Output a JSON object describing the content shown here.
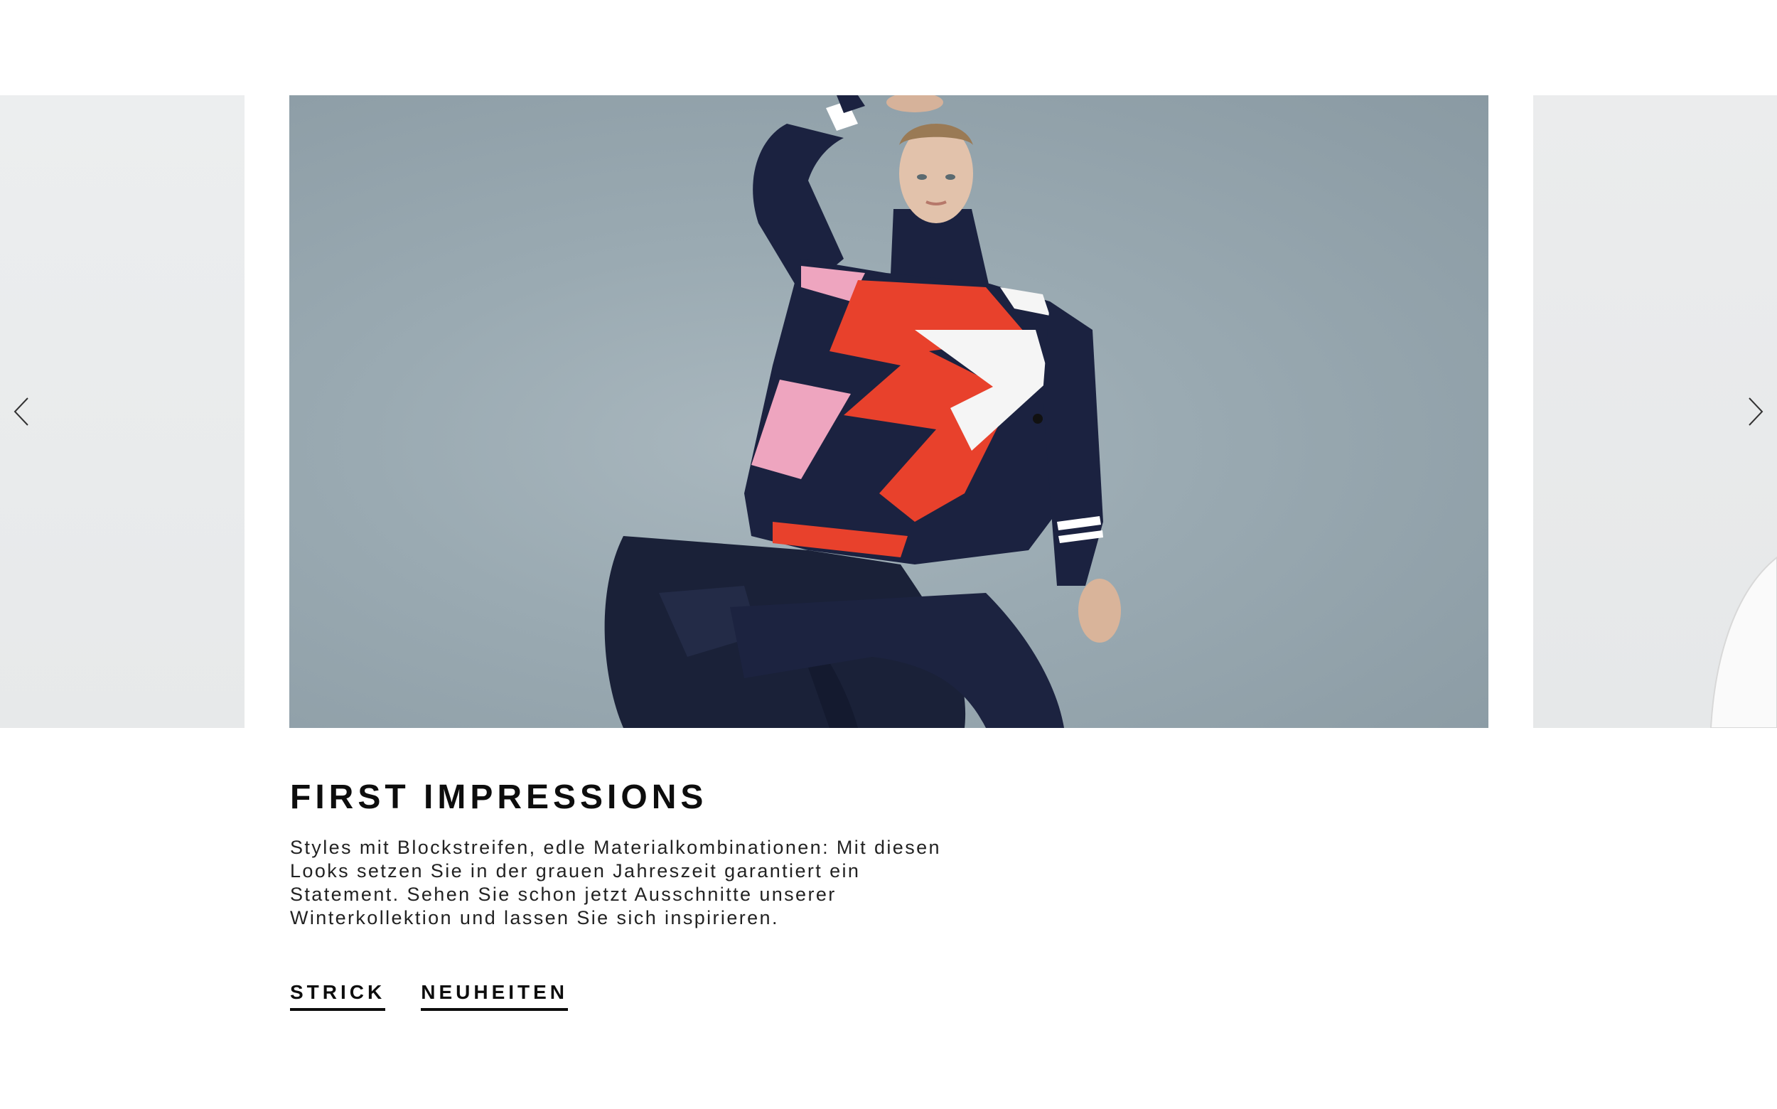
{
  "carousel": {
    "slides": [
      {
        "name": "previous-slide"
      },
      {
        "name": "current-slide",
        "image": "model-in-knit-sweater"
      },
      {
        "name": "next-slide"
      }
    ],
    "prev_icon": "chevron-left-icon",
    "next_icon": "chevron-right-icon"
  },
  "feature": {
    "title": "FIRST IMPRESSIONS",
    "description": "Styles mit Blockstreifen, edle Materialkombinationen: Mit diesen Looks setzen Sie in der grauen Jahreszeit garantiert ein Statement. Sehen Sie schon jetzt Ausschnitte unserer Winterkollektion und lassen Sie sich inspirieren.",
    "links": [
      {
        "label": "STRICK"
      },
      {
        "label": "NEUHEITEN"
      }
    ]
  },
  "colors": {
    "background": "#ffffff",
    "text": "#0d0d0d",
    "sweater_navy": "#1b2240",
    "sweater_red": "#e8412c",
    "sweater_pink": "#eea5bf"
  }
}
